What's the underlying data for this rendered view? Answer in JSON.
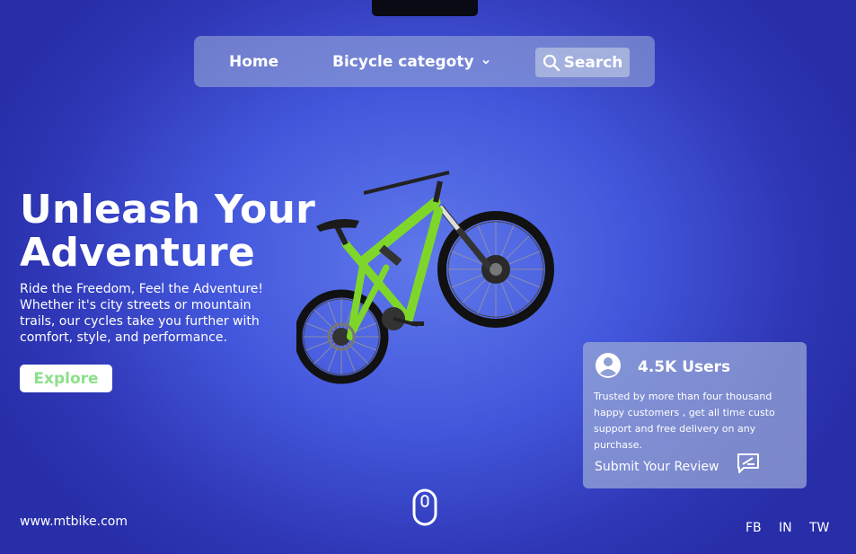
{
  "nav": {
    "home": "Home",
    "category": "Bicycle categoty",
    "search": "Search"
  },
  "hero": {
    "title": "Unleash Your Adventure",
    "description": "Ride the Freedom, Feel the Adventure! Whether it's city streets or mountain trails, our cycles take you further with comfort, style, and performance.",
    "cta": "Explore"
  },
  "stats_card": {
    "count": "4.5K Users",
    "text": "Trusted by more than four thousand happy customers , get all time custo support and free delivery on any purchase.",
    "review_link": "Submit Your Review"
  },
  "footer": {
    "website": "www.mtbike.com",
    "social": [
      "FB",
      "IN",
      "TW"
    ]
  },
  "icons": {
    "search": "search-icon",
    "dropdown": "chevron-down-icon",
    "user": "user-icon",
    "review": "review-icon",
    "scroll": "mouse-scroll-icon"
  },
  "colors": {
    "background": "#3a4ad0",
    "explore_text": "#8ce08a",
    "bike_frame": "#7fd62a"
  }
}
